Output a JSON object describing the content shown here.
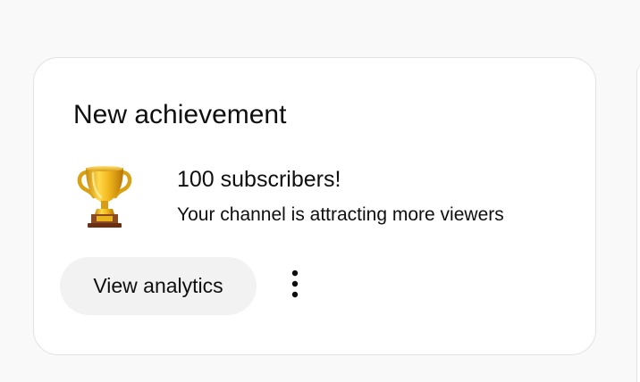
{
  "card": {
    "title": "New achievement",
    "achievement": {
      "icon": "trophy-icon",
      "headline": "100 subscribers!",
      "description": "Your channel is attracting more viewers"
    },
    "primary_action_label": "View analytics",
    "more_icon": "more-vert-icon"
  },
  "colors": {
    "page_background": "#f9f9f9",
    "card_background": "#ffffff",
    "card_border": "#e2e2e2",
    "button_background": "#f2f2f2",
    "text": "#0f0f0f",
    "trophy_gold": "#e8b31c",
    "trophy_base": "#7a3b1d"
  }
}
